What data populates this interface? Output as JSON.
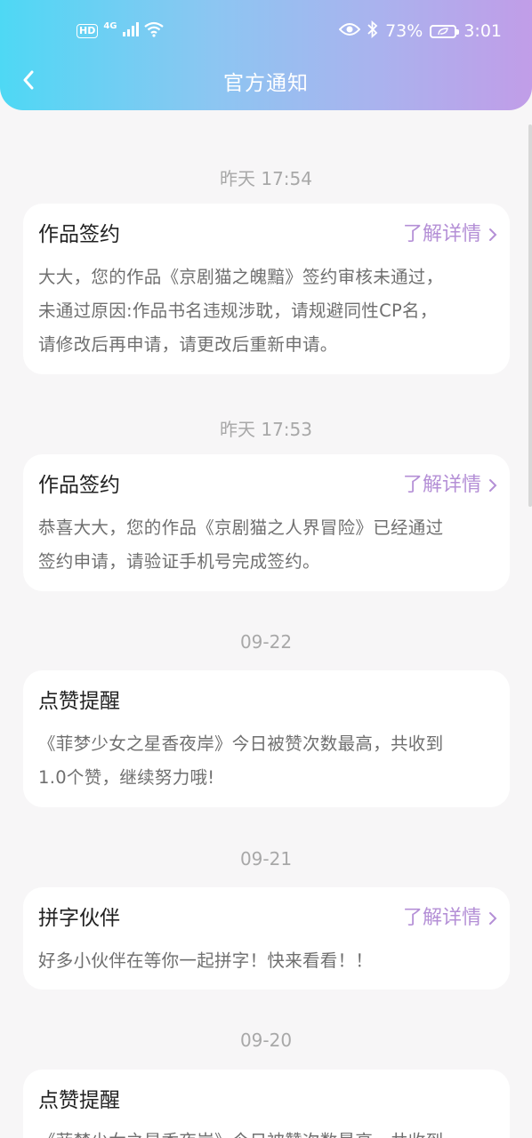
{
  "status_bar": {
    "hd": "HD",
    "network": "4G",
    "battery_percent": "73%",
    "time": "3:01"
  },
  "header": {
    "title": "官方通知"
  },
  "notifications": [
    {
      "time": "昨天 17:54",
      "title": "作品签约",
      "link": "了解详情",
      "body_lines": [
        "大大，您的作品《京剧猫之魄黯》签约审核未通过，",
        "未通过原因:作品书名违规涉耽，请规避同性CP名，",
        "请修改后再申请，请更改后重新申请。"
      ]
    },
    {
      "time": "昨天 17:53",
      "title": "作品签约",
      "link": "了解详情",
      "body_lines": [
        "恭喜大大，您的作品《京剧猫之人界冒险》已经通过",
        "签约申请，请验证手机号完成签约。"
      ]
    },
    {
      "time": "09-22",
      "title": "点赞提醒",
      "body_lines": [
        "《菲梦少女之星香夜岸》今日被赞次数最高，共收到",
        "1.0个赞，继续努力哦!"
      ]
    },
    {
      "time": "09-21",
      "title": "拼字伙伴",
      "link": "了解详情",
      "body_lines": [
        "好多小伙伴在等你一起拼字！快来看看！！"
      ]
    },
    {
      "time": "09-20",
      "title": "点赞提醒",
      "body_lines": [
        "《菲梦少女之星香夜岸》今日被赞次数最高，共收到"
      ]
    }
  ]
}
